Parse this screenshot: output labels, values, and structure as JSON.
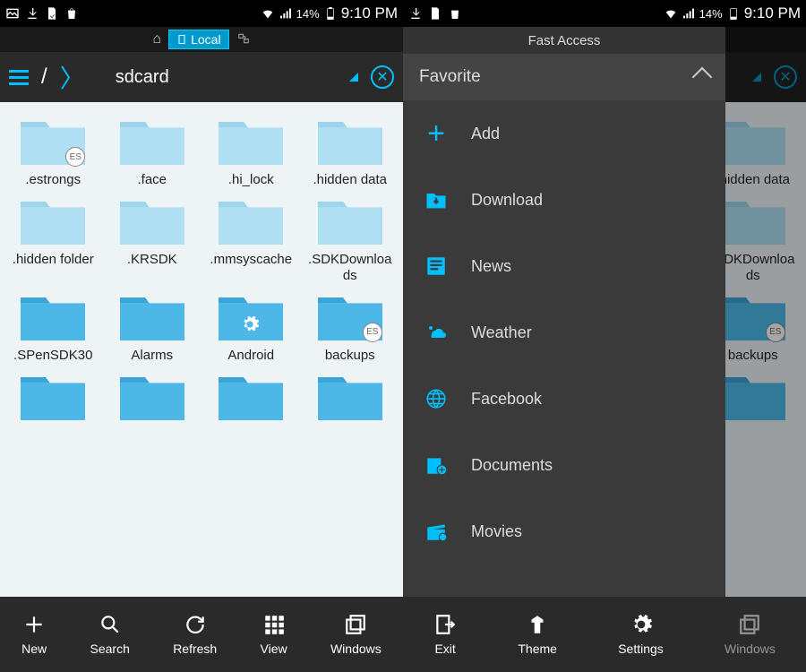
{
  "status": {
    "battery": "14%",
    "time": "9:10 PM"
  },
  "tabs": {
    "local": "Local"
  },
  "path": {
    "root": "/",
    "current": "sdcard"
  },
  "folders": [
    {
      "name": ".estrongs",
      "tint": "light",
      "badge": "es"
    },
    {
      "name": ".face",
      "tint": "light"
    },
    {
      "name": ".hi_lock",
      "tint": "light"
    },
    {
      "name": ".hidden data",
      "tint": "light"
    },
    {
      "name": ".hidden folder",
      "tint": "light"
    },
    {
      "name": ".KRSDK",
      "tint": "light"
    },
    {
      "name": ".mmsyscache",
      "tint": "light"
    },
    {
      "name": ".SDKDownloads",
      "tint": "light"
    },
    {
      "name": ".SPenSDK30",
      "tint": "dark"
    },
    {
      "name": "Alarms",
      "tint": "dark"
    },
    {
      "name": "Android",
      "tint": "dark",
      "gear": true
    },
    {
      "name": "backups",
      "tint": "dark",
      "badge": "es"
    },
    {
      "name": "",
      "tint": "dark"
    },
    {
      "name": "",
      "tint": "dark"
    },
    {
      "name": "",
      "tint": "dark"
    },
    {
      "name": "",
      "tint": "dark"
    }
  ],
  "bottom": [
    {
      "icon": "plus",
      "label": "New"
    },
    {
      "icon": "search",
      "label": "Search"
    },
    {
      "icon": "refresh",
      "label": "Refresh"
    },
    {
      "icon": "grid",
      "label": "View"
    },
    {
      "icon": "windows",
      "label": "Windows"
    }
  ],
  "drawer": {
    "title": "Fast Access",
    "section": "Favorite",
    "items": [
      {
        "icon": "plus",
        "label": "Add"
      },
      {
        "icon": "download",
        "label": "Download"
      },
      {
        "icon": "news",
        "label": "News"
      },
      {
        "icon": "weather",
        "label": "Weather"
      },
      {
        "icon": "globe",
        "label": "Facebook"
      },
      {
        "icon": "docs",
        "label": "Documents"
      },
      {
        "icon": "movies",
        "label": "Movies"
      }
    ],
    "bottom": [
      {
        "icon": "exit",
        "label": "Exit"
      },
      {
        "icon": "theme",
        "label": "Theme"
      },
      {
        "icon": "settings",
        "label": "Settings"
      }
    ]
  }
}
